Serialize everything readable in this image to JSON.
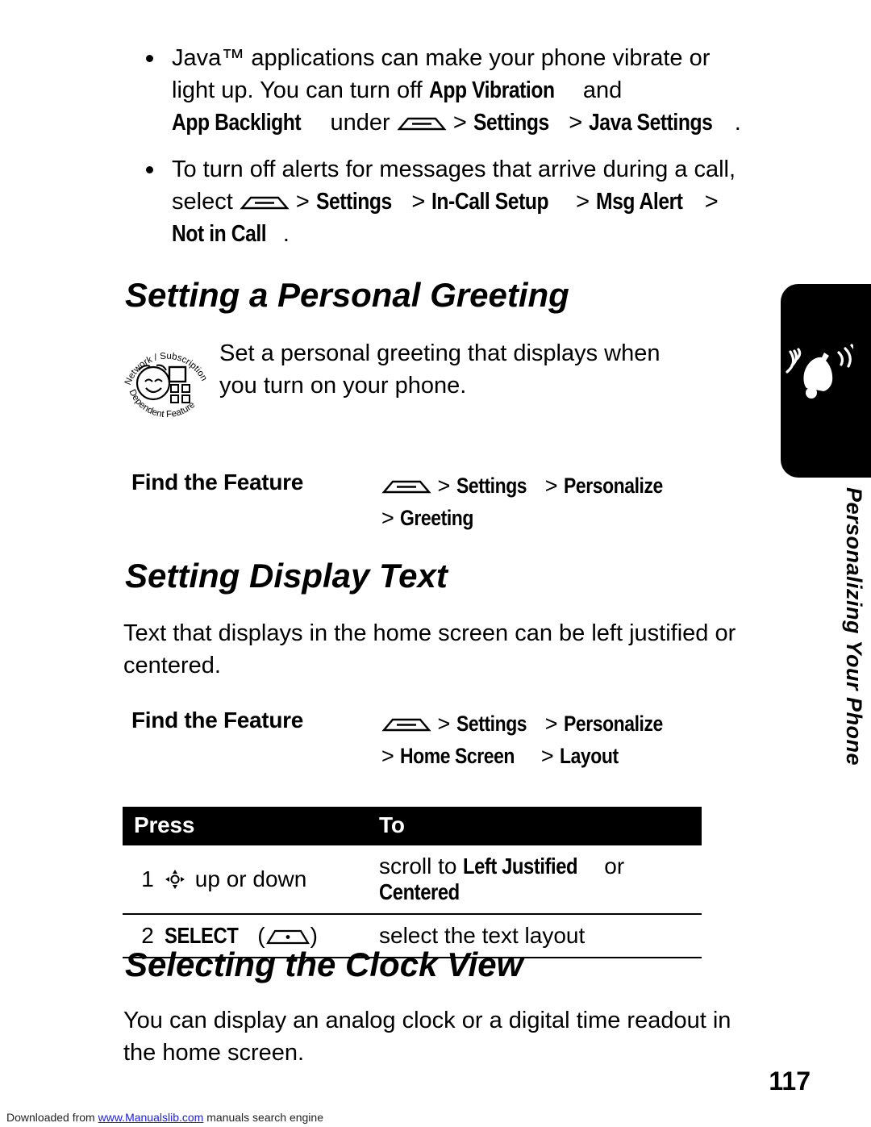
{
  "bullets": [
    {
      "segments": [
        {
          "t": "Java™ applications can make your phone vibrate or light up. You can turn off ",
          "s": "normal"
        },
        {
          "t": "App Vibration",
          "s": "key"
        },
        {
          "t": " and ",
          "s": "normal"
        },
        {
          "t": "App Backlight",
          "s": "key"
        },
        {
          "t": " under ",
          "s": "normal"
        },
        {
          "t": "MENU",
          "s": "menukey"
        },
        {
          "t": " > ",
          "s": "normal"
        },
        {
          "t": "Settings",
          "s": "key"
        },
        {
          "t": " > ",
          "s": "normal"
        },
        {
          "t": "Java Settings",
          "s": "key"
        },
        {
          "t": ".",
          "s": "normal"
        }
      ]
    },
    {
      "segments": [
        {
          "t": "To turn off alerts for messages that arrive during a call, select ",
          "s": "normal"
        },
        {
          "t": "MENU",
          "s": "menukey"
        },
        {
          "t": " > ",
          "s": "normal"
        },
        {
          "t": "Settings",
          "s": "key"
        },
        {
          "t": " > ",
          "s": "normal"
        },
        {
          "t": "In-Call Setup",
          "s": "key"
        },
        {
          "t": " > ",
          "s": "normal"
        },
        {
          "t": "Msg Alert",
          "s": "key"
        },
        {
          "t": " > ",
          "s": "normal"
        },
        {
          "t": "Not in Call",
          "s": "key"
        },
        {
          "t": ".",
          "s": "normal"
        }
      ]
    }
  ],
  "sections": {
    "greeting": {
      "heading": "Setting a Personal Greeting",
      "body": "Set a personal greeting that displays when you turn on your phone.",
      "note_icon_text": [
        "Network / Subscription",
        "Dependent Feature"
      ],
      "find_the_feature": {
        "label": "Find the Feature",
        "path_line1": [
          "MENU",
          " > ",
          "Settings",
          " > ",
          "Personalize"
        ],
        "path_line2": [
          "> ",
          "Greeting"
        ]
      }
    },
    "display_text": {
      "heading": "Setting Display Text",
      "body": "Text that displays in the home screen can be left justified or centered.",
      "find_the_feature": {
        "label": "Find the Feature",
        "path_line1": [
          "MENU",
          " > ",
          "Settings",
          " > ",
          "Personalize"
        ],
        "path_line2": [
          "> ",
          "Home Screen",
          " > ",
          "Layout"
        ]
      },
      "table": {
        "headers": [
          "Press",
          "To"
        ],
        "rows": [
          {
            "num": "1",
            "action_pre": "",
            "action_icon": "navigation-key-icon",
            "action_post": " up or down",
            "result_pre": "scroll to ",
            "result_key1": "Left Justified",
            "result_mid": " or ",
            "result_key2": "Centered",
            "result_post": ""
          },
          {
            "num": "2",
            "action_pre": "SELECT (",
            "action_icon": "select-key-icon",
            "action_post": ")",
            "result_pre": "select the text layout",
            "result_key1": "",
            "result_mid": "",
            "result_key2": "",
            "result_post": ""
          }
        ]
      }
    },
    "clock_view": {
      "heading": "Selecting the Clock View",
      "body": "You can display an analog clock or a digital time readout in the home screen."
    }
  },
  "side_tab": {
    "title": "Personalizing Your Phone",
    "icon": "alert-bell-icon"
  },
  "page_number": "117",
  "footer": {
    "prefix": "Downloaded from ",
    "link": "www.Manualslib.com",
    "suffix": " manuals search engine"
  }
}
